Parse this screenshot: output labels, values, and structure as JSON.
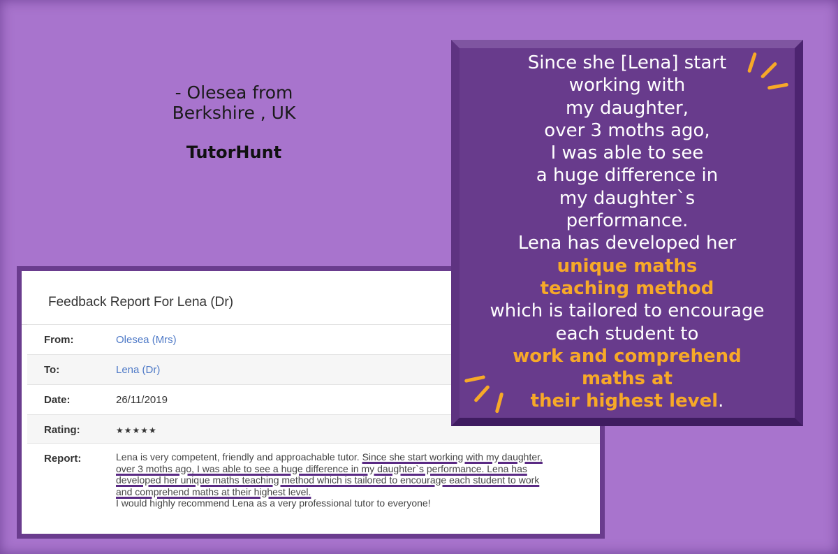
{
  "attribution": {
    "line1": "- Olesea from",
    "line2": "Berkshire , UK",
    "source": "TutorHunt"
  },
  "feedback": {
    "title": "Feedback Report For Lena (Dr)",
    "rows": [
      {
        "label": "From:",
        "value": "Olesea (Mrs)"
      },
      {
        "label": "To:",
        "value": "Lena (Dr)"
      },
      {
        "label": "Date:",
        "value": "26/11/2019"
      },
      {
        "label": "Rating:",
        "value": "★★★★★"
      }
    ],
    "report_label": "Report:",
    "report_plain_1": "Lena is very competent, friendly and approachable tutor. ",
    "report_highlight": "Since she start working with my daughter, over 3 moths ago, I was able to see a huge difference in my daughter`s performance. Lena has developed her unique maths teaching method which is tailored to encourage each student to work and comprehend maths at their highest level.",
    "report_plain_2": "I would highly recommend Lena as a very professional tutor to everyone!"
  },
  "quote": {
    "l1": "Since she [Lena] start",
    "l2": "working with",
    "l3": "my daughter,",
    "l4": "over 3 moths ago,",
    "l5": "I was able to see",
    "l6": "a huge difference in",
    "l7": "my daughter`s",
    "l8": "performance.",
    "l9": "Lena has developed her",
    "l10": "unique maths",
    "l11": "teaching method",
    "l12": "which is tailored to encourage",
    "l13": "each student to",
    "l14": "work and comprehend",
    "l15": "maths at",
    "l16": "their highest level",
    "l16_end": ".",
    "accent_color": "#f7a928"
  }
}
